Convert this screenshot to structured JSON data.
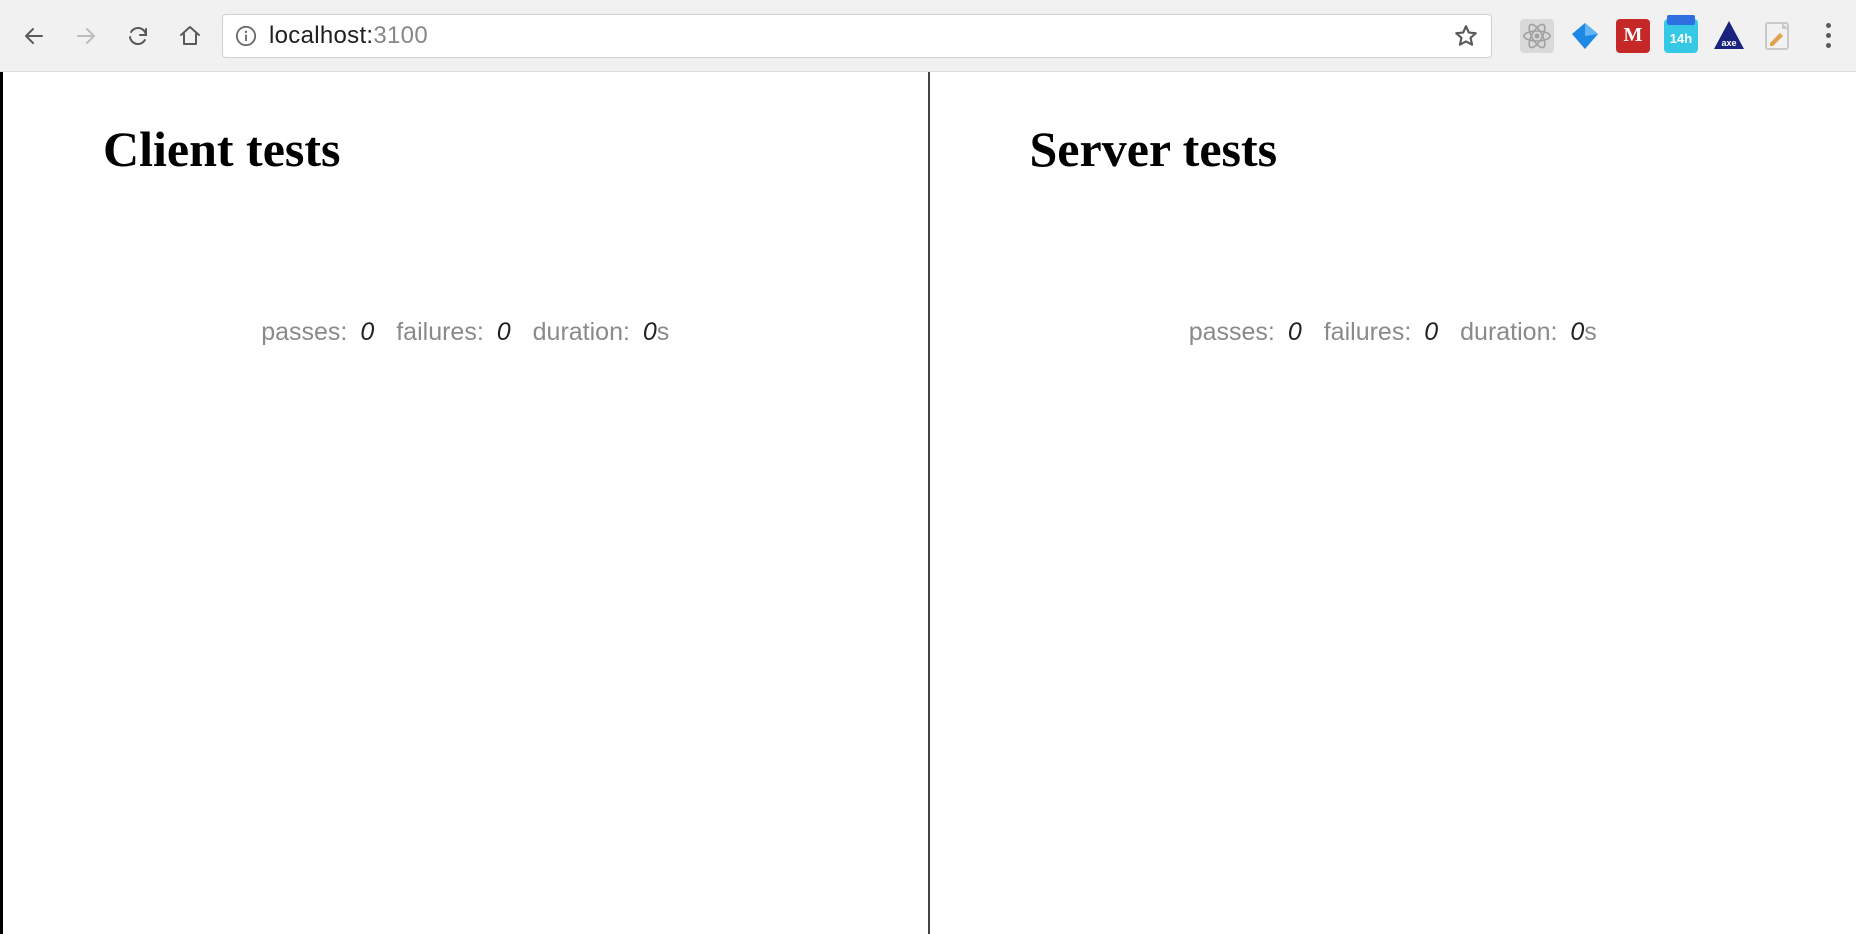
{
  "browser": {
    "url_host": "localhost:",
    "url_port": "3100"
  },
  "panels": {
    "client": {
      "title": "Client tests",
      "stats": {
        "passes_label": "passes:",
        "passes_value": "0",
        "failures_label": "failures:",
        "failures_value": "0",
        "duration_label": "duration:",
        "duration_value": "0",
        "duration_unit": "s"
      }
    },
    "server": {
      "title": "Server tests",
      "stats": {
        "passes_label": "passes:",
        "passes_value": "0",
        "failures_label": "failures:",
        "failures_value": "0",
        "duration_label": "duration:",
        "duration_value": "0",
        "duration_unit": "s"
      }
    }
  },
  "extensions": {
    "m_label": "M",
    "timer_label": "14h",
    "axe_label": "axe"
  }
}
